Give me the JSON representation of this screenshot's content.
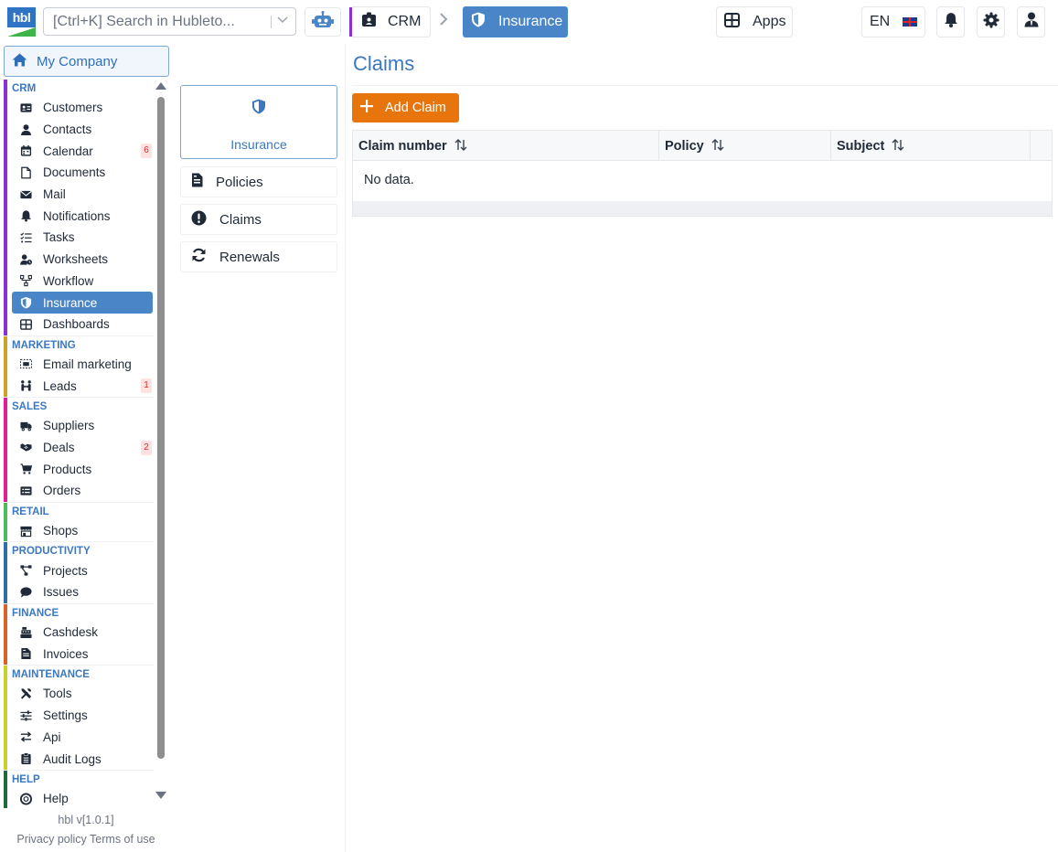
{
  "app": {
    "logo_text": "hbl",
    "search_placeholder": "[Ctrl+K] Search in Hubleto..."
  },
  "breadcrumb": {
    "crm": "CRM",
    "current": "Insurance"
  },
  "header": {
    "apps_label": "Apps",
    "language": "EN"
  },
  "sidebar": {
    "my_company": "My Company",
    "groups": [
      {
        "title": "CRM",
        "color": "#8b2fd6",
        "items": [
          {
            "label": "Customers"
          },
          {
            "label": "Contacts"
          },
          {
            "label": "Calendar",
            "badge": "6"
          },
          {
            "label": "Documents"
          },
          {
            "label": "Mail"
          },
          {
            "label": "Notifications"
          },
          {
            "label": "Tasks"
          },
          {
            "label": "Worksheets"
          },
          {
            "label": "Workflow"
          },
          {
            "label": "Insurance",
            "active": true
          },
          {
            "label": "Dashboards"
          }
        ]
      },
      {
        "title": "MARKETING",
        "color": "#c9a227",
        "items": [
          {
            "label": "Email marketing"
          },
          {
            "label": "Leads",
            "badge": "1"
          }
        ]
      },
      {
        "title": "SALES",
        "color": "#e11d9a",
        "items": [
          {
            "label": "Suppliers"
          },
          {
            "label": "Deals",
            "badge": "2"
          },
          {
            "label": "Products"
          },
          {
            "label": "Orders"
          }
        ]
      },
      {
        "title": "RETAIL",
        "color": "#4cbb5a",
        "items": [
          {
            "label": "Shops"
          }
        ]
      },
      {
        "title": "PRODUCTIVITY",
        "color": "#2f6fa8",
        "items": [
          {
            "label": "Projects"
          },
          {
            "label": "Issues"
          }
        ]
      },
      {
        "title": "FINANCE",
        "color": "#d9622b",
        "items": [
          {
            "label": "Cashdesk"
          },
          {
            "label": "Invoices"
          }
        ]
      },
      {
        "title": "MAINTENANCE",
        "color": "#c7d12a",
        "items": [
          {
            "label": "Tools"
          },
          {
            "label": "Settings"
          },
          {
            "label": "Api"
          },
          {
            "label": "Audit Logs"
          }
        ]
      },
      {
        "title": "HELP",
        "color": "#1d6b3a",
        "items": [
          {
            "label": "Help"
          }
        ]
      }
    ],
    "version": "hbl v[1.0.1]",
    "privacy": "Privacy policy",
    "terms": "Terms of use"
  },
  "midnav": {
    "card_label": "Insurance",
    "links": [
      {
        "label": "Policies"
      },
      {
        "label": "Claims"
      },
      {
        "label": "Renewals"
      }
    ]
  },
  "main": {
    "title": "Claims",
    "add_button": "Add Claim",
    "columns": [
      "Claim number",
      "Policy",
      "Subject"
    ],
    "empty_text": "No data."
  },
  "colors": {
    "accent": "#4a86c7",
    "action": "#e8750c",
    "badge": "#d92d2d"
  }
}
